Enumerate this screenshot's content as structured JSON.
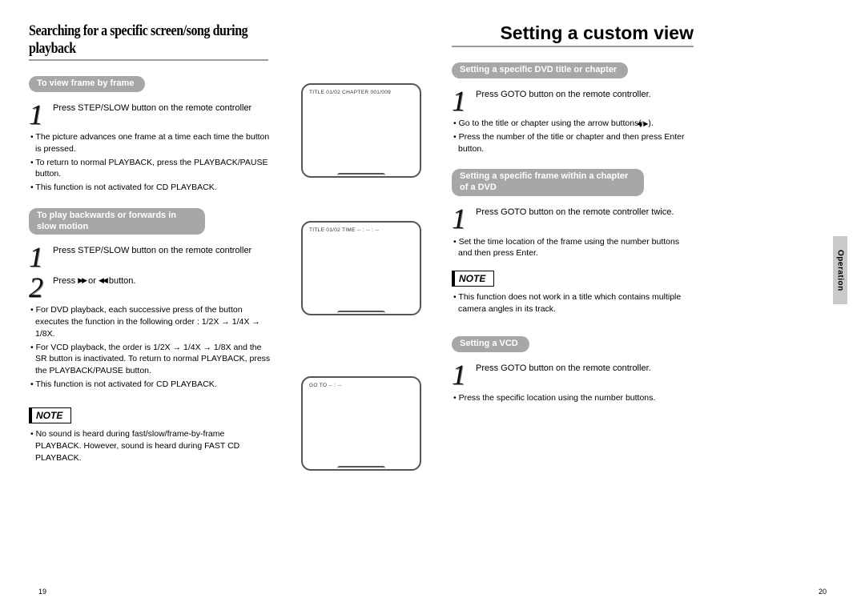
{
  "left": {
    "heading": "Searching for a specific screen/song during playback",
    "section1": {
      "pill": "To view frame by frame",
      "step1": "Press STEP/SLOW button on the remote controller",
      "bullets": [
        "The picture advances one frame at a time each time the button is pressed.",
        "To return to normal PLAYBACK, press the PLAYBACK/PAUSE button.",
        "This function is not activated for CD PLAYBACK."
      ]
    },
    "section2": {
      "pill": "To play backwards or forwards in slow motion",
      "step1": "Press STEP/SLOW button on the remote controller",
      "step2_pre": "Press ",
      "step2_mid": " or ",
      "step2_post": " button.",
      "bullets": [
        "For DVD playback, each successive press of the button executes the function in the following order : 1/2X → 1/4X → 1/8X.",
        "For VCD playback, the order is 1/2X → 1/4X → 1/8X and the SR button is inactivated. To return to normal PLAYBACK, press the PLAYBACK/PAUSE button.",
        "This function is not activated for CD PLAYBACK."
      ]
    },
    "note_label": "NOTE",
    "note_text": "No sound is heard during fast/slow/frame-by-frame PLAYBACK. However, sound is heard during FAST CD PLAYBACK.",
    "pagenum": "19"
  },
  "mid": {
    "screen1_label": "TITLE 01/02    CHAPTER    001/009",
    "screen2_label": "TITLE 01/02    TIME    -- : -- : --",
    "screen3_label": "GO TO    -- : --"
  },
  "right": {
    "heading": "Setting a custom view",
    "section1": {
      "pill": "Setting a specific DVD title or chapter",
      "step1": "Press GOTO button on the remote controller.",
      "bullet1_pre": "Go to the title or chapter using the arrow buttons(",
      "bullet1_post": ").",
      "bullet2": "Press the number of the title or chapter and then press Enter button."
    },
    "section2": {
      "pill": "Setting a specific frame within a chapter of a DVD",
      "step1": "Press GOTO button on the remote controller twice.",
      "bullets": [
        "Set the time location of the frame using the number buttons and then press Enter."
      ],
      "note_label": "NOTE",
      "note_text": "This function does not work in a title which contains multiple camera angles in its track."
    },
    "section3": {
      "pill": "Setting a VCD",
      "step1": "Press GOTO button on the remote controller.",
      "bullets": [
        "Press the specific location using the number buttons."
      ]
    },
    "pagenum": "20"
  },
  "tab": "Operation"
}
